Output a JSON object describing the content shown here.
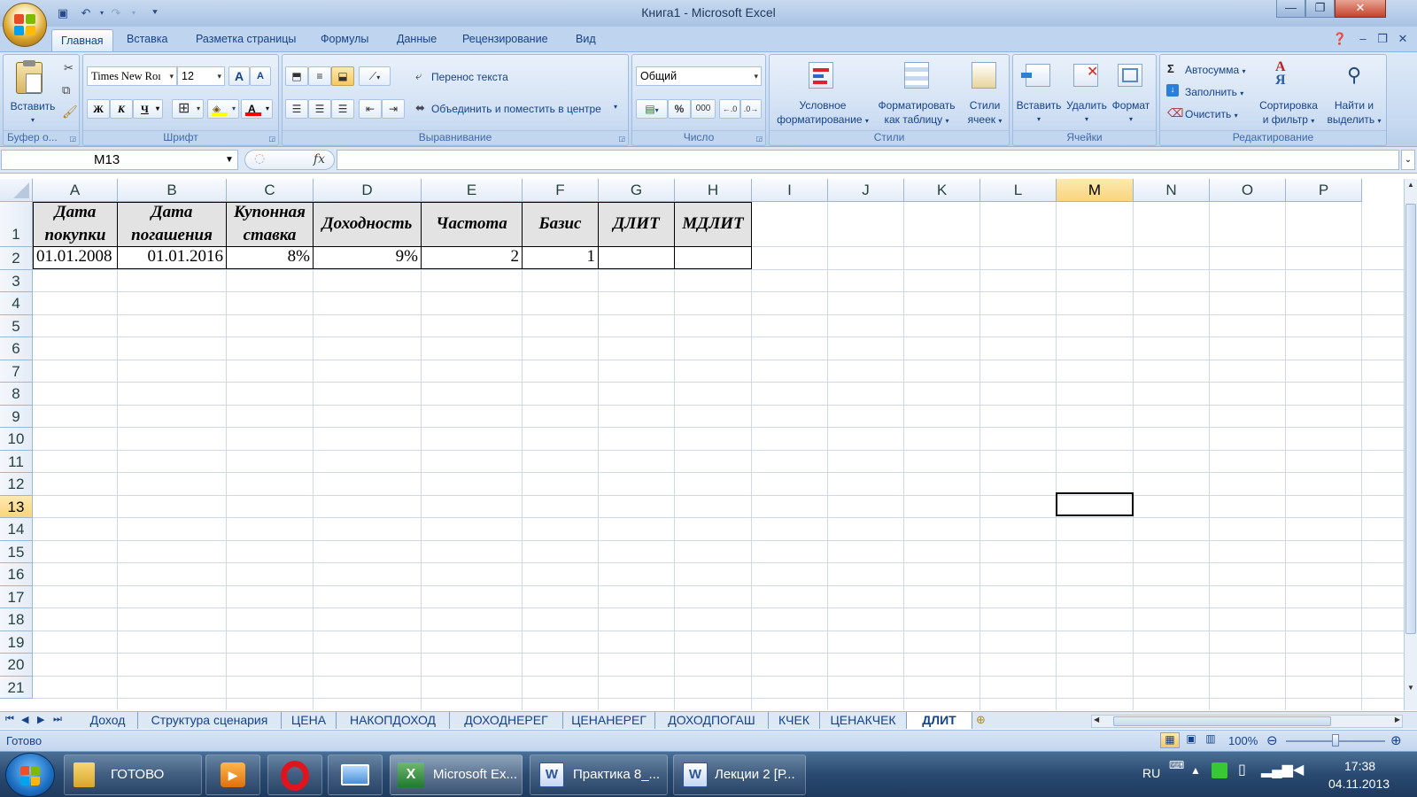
{
  "window": {
    "title": "Книга1 - Microsoft Excel"
  },
  "ribbon_tabs": [
    "Главная",
    "Вставка",
    "Разметка страницы",
    "Формулы",
    "Данные",
    "Рецензирование",
    "Вид"
  ],
  "clipboard": {
    "paste": "Вставить",
    "group": "Буфер о..."
  },
  "font": {
    "name": "Times New Roı",
    "size": "12",
    "bold": "Ж",
    "italic": "К",
    "underline": "Ч",
    "grow": "A",
    "shrink": "A",
    "color": "A",
    "group": "Шрифт"
  },
  "alignment": {
    "wrap": "Перенос текста",
    "merge": "Объединить и поместить в центре",
    "group": "Выравнивание"
  },
  "number": {
    "format": "Общий",
    "percent": "%",
    "thousands": "000",
    "group": "Число"
  },
  "styles": {
    "conditional": [
      "Условное",
      "форматирование"
    ],
    "as_table": [
      "Форматировать",
      "как таблицу"
    ],
    "cell_styles": [
      "Стили",
      "ячеек"
    ],
    "group": "Стили"
  },
  "cells": {
    "insert": "Вставить",
    "delete": "Удалить",
    "format": "Формат",
    "group": "Ячейки"
  },
  "editing": {
    "autosum": "Автосумма",
    "fill": "Заполнить",
    "clear": "Очистить",
    "sort": [
      "Сортировка",
      "и фильтр"
    ],
    "find": [
      "Найти и",
      "выделить"
    ],
    "group": "Редактирование",
    "sigma": "Σ"
  },
  "formula_bar": {
    "name_box": "M13",
    "fx": "fx",
    "formula": ""
  },
  "columns": [
    "A",
    "B",
    "C",
    "D",
    "E",
    "F",
    "G",
    "H",
    "I",
    "J",
    "K",
    "L",
    "M",
    "N",
    "O",
    "P"
  ],
  "rows": [
    "1",
    "2",
    "3",
    "4",
    "5",
    "6",
    "7",
    "8",
    "9",
    "10",
    "11",
    "12",
    "13",
    "14",
    "15",
    "16",
    "17",
    "18",
    "19",
    "20",
    "21"
  ],
  "table": {
    "headers": [
      [
        "Дата",
        "покупки"
      ],
      [
        "Дата",
        "погашения"
      ],
      [
        "Купонная",
        "ставка"
      ],
      [
        "Доходность"
      ],
      [
        "Частота"
      ],
      [
        "Базис"
      ],
      [
        "ДЛИТ"
      ],
      [
        "МДЛИТ"
      ]
    ],
    "row2": [
      "01.01.2008",
      "01.01.2016",
      "8%",
      "9%",
      "2",
      "1",
      "",
      ""
    ]
  },
  "active_cell": {
    "column": "M",
    "row": "13"
  },
  "sheet_tabs": [
    "Доход",
    "Структура сценария",
    "ЦЕНА",
    "НАКОПДОХОД",
    "ДОХОДНЕРЕГ",
    "ЦЕНАНЕРЕГ",
    "ДОХОДПОГАШ",
    "КЧЕК",
    "ЦЕНАКЧЕК",
    "ДЛИТ"
  ],
  "active_sheet": "ДЛИТ",
  "status": {
    "text": "Готово",
    "zoom": "100%"
  },
  "taskbar": {
    "items": [
      "ГОТОВО",
      "Microsoft Ex...",
      "Практика 8_...",
      "Лекции 2 [Р..."
    ],
    "lang": "RU",
    "time": "17:38",
    "date": "04.11.2013"
  },
  "colors": {
    "accent": "#15428b",
    "ribbon": "#c6d9f1",
    "header_fill": "#e3e3e3",
    "selected_header": "#f9d57c"
  }
}
